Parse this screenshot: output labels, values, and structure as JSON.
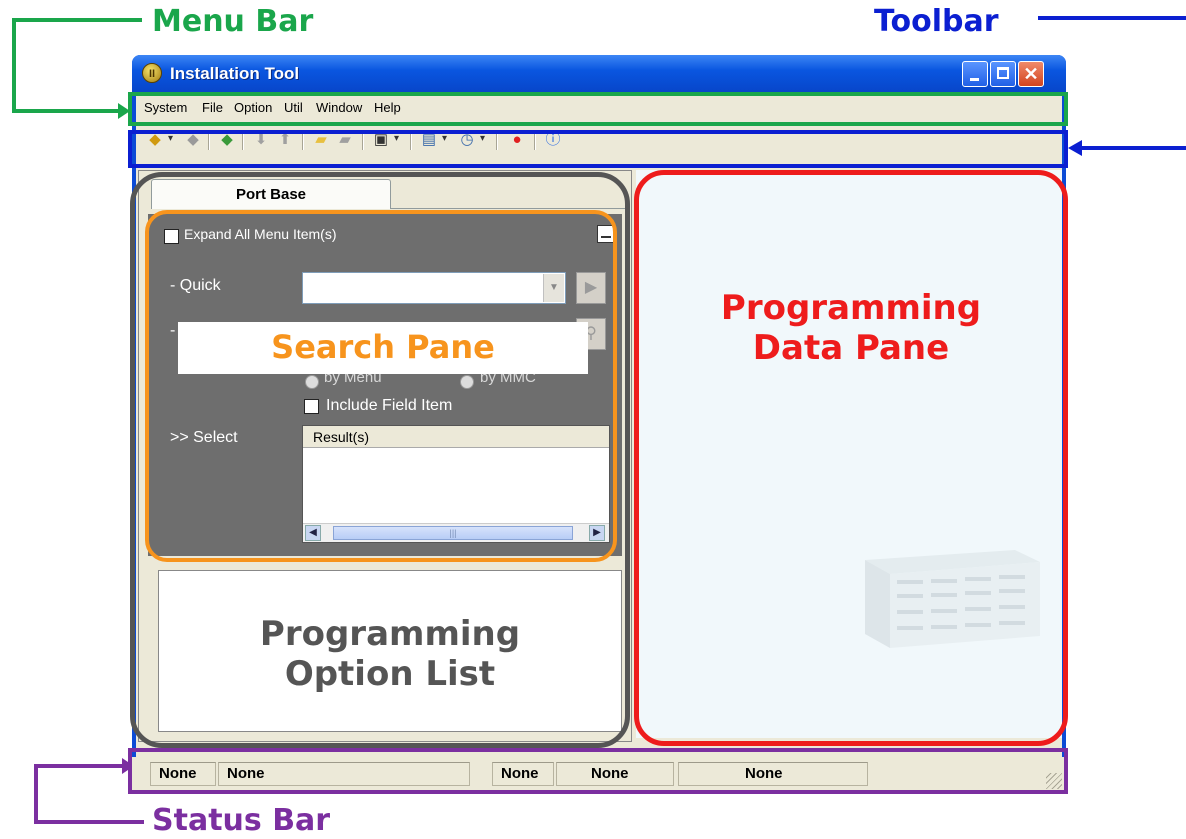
{
  "annotations": {
    "menu_bar": "Menu Bar",
    "toolbar": "Toolbar",
    "search_pane": "Search Pane",
    "programming_data_pane": "Programming Data Pane",
    "programming_data_pane_line1": "Programming",
    "programming_data_pane_line2": "Data Pane",
    "programming_option_list_line1": "Programming",
    "programming_option_list_line2": "Option List",
    "status_bar": "Status Bar",
    "colors": {
      "menu_bar": "#1aa64b",
      "toolbar": "#0b1fd1",
      "search_pane": "#f7941d",
      "programming_data_pane": "#ee1c1c",
      "programming_option_list": "#555555",
      "status_bar": "#7b2fa0"
    }
  },
  "window": {
    "title": "Installation Tool",
    "title_icon": "installation-tool-icon",
    "controls": [
      "minimize-icon",
      "maximize-icon",
      "close-icon"
    ]
  },
  "menu": {
    "items": [
      "System",
      "File",
      "Option",
      "Util",
      "Window",
      "Help"
    ]
  },
  "toolbar": {
    "icons": [
      "connect-icon",
      "disconnect-icon",
      "refresh-icon",
      "download-icon",
      "upload-icon",
      "open-folder-icon",
      "save-icon",
      "export-icon",
      "user-settings-icon",
      "schedule-icon",
      "stop-icon",
      "info-icon"
    ]
  },
  "left_pane": {
    "tab_label": "Port Base",
    "expand_all_label": "Expand All Menu Item(s)",
    "quick_label": "- Quick",
    "quick_value": "",
    "by_menu_label": "by Menu",
    "by_mmc_label": "by MMC",
    "include_field_label": "Include Field Item",
    "select_label": ">> Select",
    "results_header": "Result(s)"
  },
  "status_bar": {
    "panels": [
      "None",
      "None",
      "None",
      "None",
      "None"
    ]
  }
}
